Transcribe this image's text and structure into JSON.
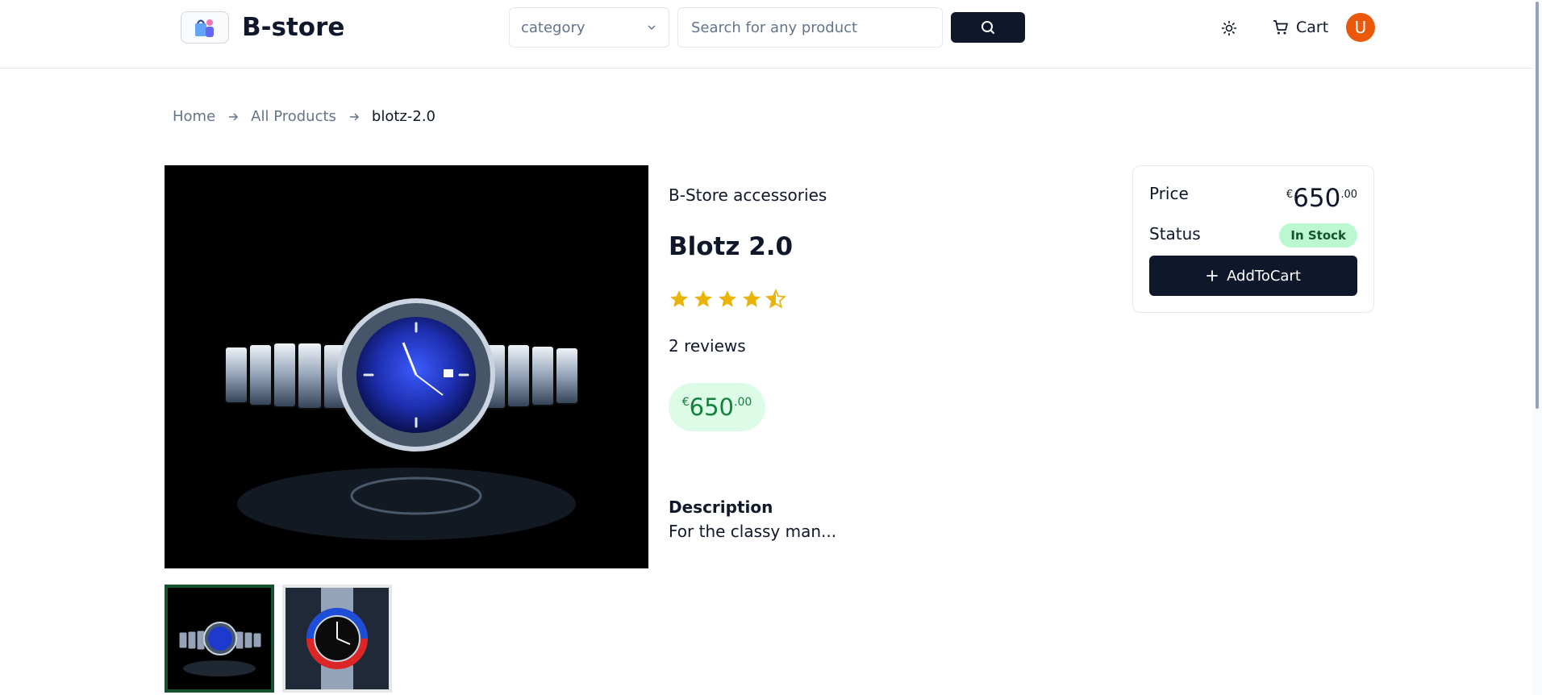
{
  "header": {
    "brand": "B-store",
    "logo_icon": "shopping-user-icon",
    "category_label": "category",
    "search_placeholder": "Search for any product",
    "search_icon": "search-icon",
    "theme_icon": "sun-icon",
    "cart_label": "Cart",
    "avatar_initial": "U"
  },
  "breadcrumb": {
    "items": [
      "Home",
      "All Products",
      "blotz-2.0"
    ]
  },
  "product": {
    "brand": "B-Store accessories",
    "name": "Blotz 2.0",
    "rating": 4.5,
    "rating_max": 5,
    "reviews": "2 reviews",
    "currency": "€",
    "price_whole": "650",
    "price_cents": ".00",
    "description_heading": "Description",
    "description": "For the classy man...",
    "thumbnails": [
      "blue-dial-watch",
      "pepsi-bezel-watch"
    ]
  },
  "purchase": {
    "price_label": "Price",
    "status_label": "Status",
    "status_value": "In Stock",
    "add_button": "AddToCart"
  },
  "colors": {
    "primary": "#0f172a",
    "accent_green": "#15803d",
    "avatar": "#ea580c",
    "star": "#eab308"
  }
}
